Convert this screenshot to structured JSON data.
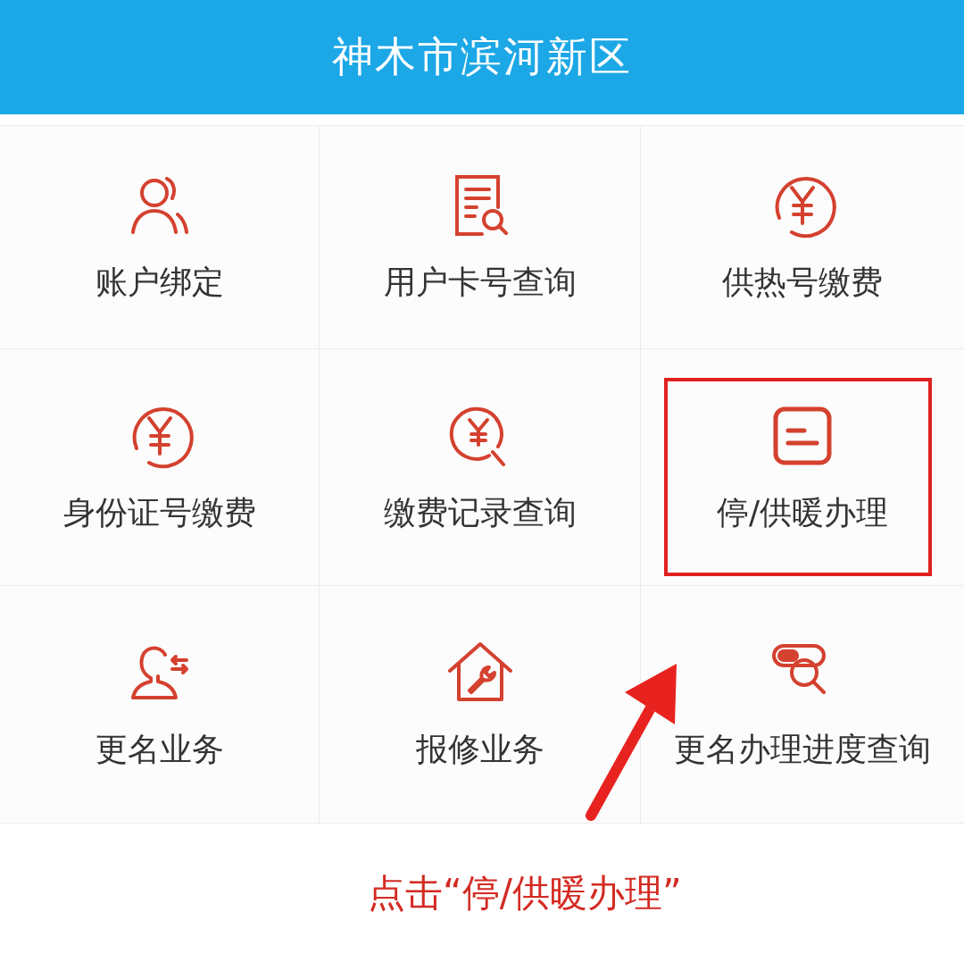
{
  "header": {
    "title": "神木市滨河新区"
  },
  "tiles": [
    {
      "label": "账户绑定",
      "kind": "person",
      "highlighted": false
    },
    {
      "label": "用户卡号查询",
      "kind": "document-search",
      "highlighted": false
    },
    {
      "label": "供热号缴费",
      "kind": "yen",
      "highlighted": false
    },
    {
      "label": "身份证号缴费",
      "kind": "yen",
      "highlighted": false
    },
    {
      "label": "缴费记录查询",
      "kind": "yen-search",
      "highlighted": false
    },
    {
      "label": "停/供暖办理",
      "kind": "lines-box",
      "highlighted": true
    },
    {
      "label": "更名业务",
      "kind": "person-swap",
      "highlighted": false
    },
    {
      "label": "报修业务",
      "kind": "house-wrench",
      "highlighted": false
    },
    {
      "label": "更名办理进度查询",
      "kind": "toggle-search",
      "highlighted": false
    }
  ],
  "caption": "点击“停/供暖办理”"
}
